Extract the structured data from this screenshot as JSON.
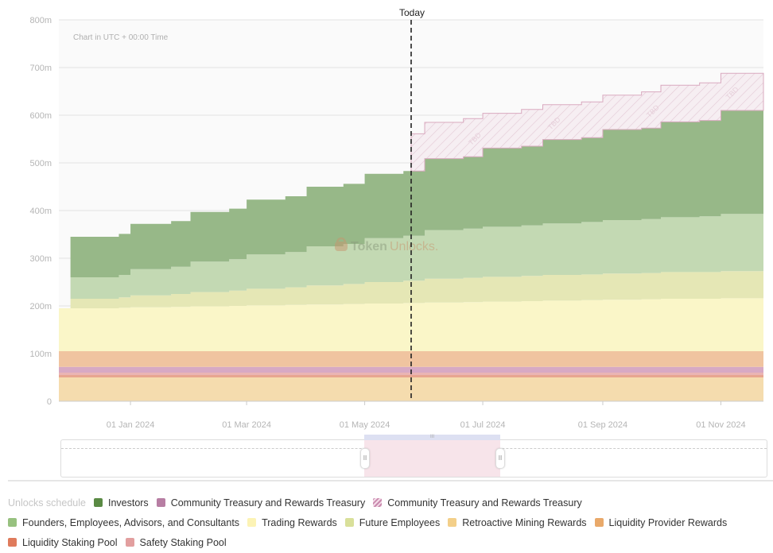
{
  "chart_data": {
    "type": "area",
    "stacked": true,
    "step": true,
    "title": "",
    "note": "Chart in UTC + 00:00 Time",
    "today_label": "Today",
    "today_date": "2024-05-25",
    "watermark": {
      "part1": "Token",
      "part2": "Unlocks."
    },
    "x_range": [
      "2023-11-25",
      "2024-11-23"
    ],
    "x_ticks": [
      {
        "date": "2024-01-01",
        "label": "01 Jan 2024"
      },
      {
        "date": "2024-03-01",
        "label": "01 Mar 2024"
      },
      {
        "date": "2024-05-01",
        "label": "01 May 2024"
      },
      {
        "date": "2024-07-01",
        "label": "01 Jul 2024"
      },
      {
        "date": "2024-09-01",
        "label": "01 Sep 2024"
      },
      {
        "date": "2024-11-01",
        "label": "01 Nov 2024"
      }
    ],
    "ylim": [
      0,
      800
    ],
    "y_ticks": [
      {
        "value": 0,
        "label": "0"
      },
      {
        "value": 100,
        "label": "100m"
      },
      {
        "value": 200,
        "label": "200m"
      },
      {
        "value": 300,
        "label": "300m"
      },
      {
        "value": 400,
        "label": "400m"
      },
      {
        "value": 500,
        "label": "500m"
      },
      {
        "value": 600,
        "label": "600m"
      },
      {
        "value": 700,
        "label": "700m"
      },
      {
        "value": 800,
        "label": "800m"
      }
    ],
    "grid": true,
    "dates": [
      "2023-11-25",
      "2023-12-01",
      "2023-12-26",
      "2024-01-01",
      "2024-01-22",
      "2024-02-01",
      "2024-02-21",
      "2024-03-01",
      "2024-03-21",
      "2024-04-01",
      "2024-04-20",
      "2024-05-01",
      "2024-05-21",
      "2024-05-25",
      "2024-06-01",
      "2024-06-21",
      "2024-07-01",
      "2024-07-21",
      "2024-08-01",
      "2024-08-21",
      "2024-09-01",
      "2024-09-21",
      "2024-10-01",
      "2024-10-21",
      "2024-11-01",
      "2024-11-23"
    ],
    "series": [
      {
        "name": "Retroactive Mining Rewards",
        "color": "#f5dcae",
        "values": [
          50,
          50,
          50,
          50,
          50,
          50,
          50,
          50,
          50,
          50,
          50,
          50,
          50,
          50,
          50,
          50,
          50,
          50,
          50,
          50,
          50,
          50,
          50,
          50,
          50,
          50
        ]
      },
      {
        "name": "Liquidity Staking Pool",
        "color": "#e8a590",
        "values": [
          5,
          5,
          5,
          5,
          5,
          5,
          5,
          5,
          5,
          5,
          5,
          5,
          5,
          5,
          5,
          5,
          5,
          5,
          5,
          5,
          5,
          5,
          5,
          5,
          5,
          5
        ]
      },
      {
        "name": "Safety Staking Pool",
        "color": "#eab4b4",
        "values": [
          5,
          5,
          5,
          5,
          5,
          5,
          5,
          5,
          5,
          5,
          5,
          5,
          5,
          5,
          5,
          5,
          5,
          5,
          5,
          5,
          5,
          5,
          5,
          5,
          5,
          5
        ]
      },
      {
        "name": "Community Treasury and Rewards Treasury",
        "color": "#d7a9c4",
        "values": [
          12,
          12,
          12,
          12,
          12,
          12,
          12,
          12,
          12,
          12,
          12,
          12,
          12,
          12,
          12,
          12,
          12,
          12,
          12,
          12,
          12,
          12,
          12,
          12,
          12,
          12
        ]
      },
      {
        "name": "Liquidity Provider Rewards",
        "color": "#f0c4a0",
        "values": [
          33,
          33,
          33,
          33,
          33,
          33,
          33,
          33,
          33,
          33,
          33,
          33,
          33,
          33,
          33,
          33,
          33,
          33,
          33,
          33,
          33,
          33,
          33,
          33,
          33,
          33
        ]
      },
      {
        "name": "Trading Rewards",
        "color": "#faf6c8",
        "values": [
          90,
          90,
          91,
          92,
          93,
          94,
          95,
          96,
          97,
          98,
          99,
          100,
          101,
          101,
          102,
          103,
          104,
          105,
          106,
          107,
          108,
          109,
          110,
          110,
          111,
          111
        ]
      },
      {
        "name": "Future Employees",
        "color": "#e5e7b5",
        "values": [
          0,
          20,
          22,
          25,
          27,
          30,
          32,
          35,
          37,
          40,
          42,
          45,
          47,
          47,
          50,
          51,
          52,
          53,
          54,
          54,
          55,
          55,
          56,
          56,
          57,
          57
        ]
      },
      {
        "name": "Founders, Employees, Advisors, and Consultants",
        "color": "#c3d9b3",
        "values": [
          0,
          45,
          47,
          55,
          57,
          64,
          66,
          72,
          74,
          82,
          84,
          92,
          94,
          94,
          102,
          103,
          105,
          106,
          108,
          110,
          112,
          113,
          115,
          117,
          120,
          120
        ]
      },
      {
        "name": "Investors",
        "color": "#97b888",
        "values": [
          0,
          85,
          86,
          95,
          96,
          104,
          106,
          115,
          117,
          125,
          126,
          135,
          136,
          136,
          150,
          151,
          165,
          166,
          176,
          177,
          190,
          191,
          200,
          201,
          217,
          217
        ]
      },
      {
        "name": "Community Treasury and Rewards Treasury",
        "color": "#f4e8ee",
        "hatched": true,
        "label": "TBD",
        "values": [
          0,
          0,
          0,
          0,
          0,
          0,
          0,
          0,
          0,
          0,
          0,
          0,
          0,
          78,
          76,
          80,
          73,
          77,
          73,
          75,
          72,
          76,
          77,
          79,
          78,
          78
        ]
      }
    ]
  },
  "navigator": {
    "handle_glyph": "II",
    "grip_glyph": "III"
  },
  "legend": {
    "title": "Unlocks schedule",
    "rows": [
      [
        {
          "label": "Investors",
          "color": "#5a8a44"
        },
        {
          "label": "Community Treasury and Rewards Treasury",
          "color": "#b77ea3"
        },
        {
          "label": "Community Treasury and Rewards Treasury",
          "color": "#c98aae",
          "hatched": true
        }
      ],
      [
        {
          "label": "Founders, Employees, Advisors, and Consultants",
          "color": "#97c17f"
        },
        {
          "label": "Trading Rewards",
          "color": "#fcf3b5"
        },
        {
          "label": "Future Employees",
          "color": "#d9e09a"
        },
        {
          "label": "Retroactive Mining Rewards",
          "color": "#f3cf89"
        },
        {
          "label": "Liquidity Provider Rewards",
          "color": "#e9a96a"
        }
      ],
      [
        {
          "label": "Liquidity Staking Pool",
          "color": "#df7b5c"
        },
        {
          "label": "Safety Staking Pool",
          "color": "#e29f9f"
        }
      ]
    ]
  }
}
